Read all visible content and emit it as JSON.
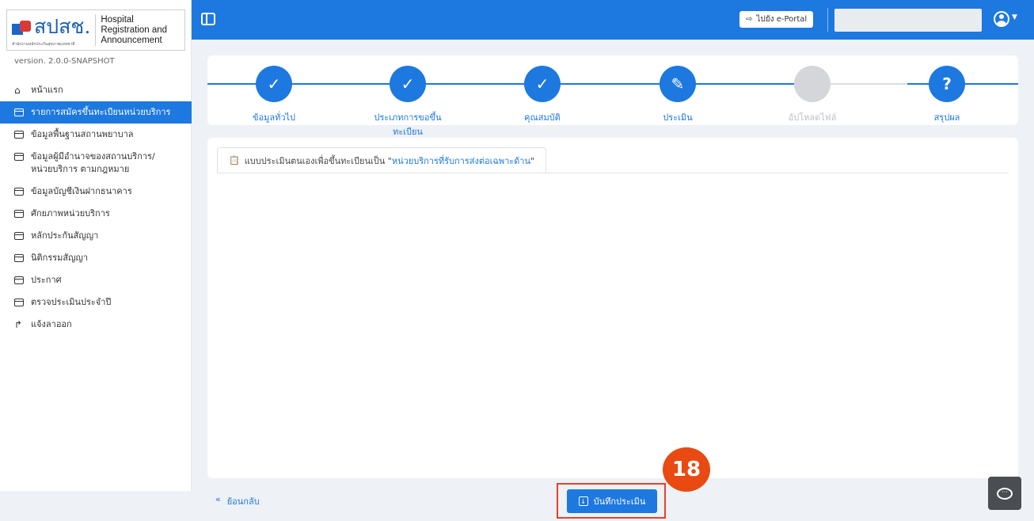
{
  "logo": {
    "thai": "สปสช.",
    "sub": "สำนักงานหลักประกันสุขภาพแห่งชาติ",
    "eng_lines": [
      "Hospital",
      "Registration and",
      "Announcement"
    ]
  },
  "version": "version. 2.0.0-SNAPSHOT",
  "sidebar": {
    "items": [
      {
        "label": "หน้าแรก",
        "icon": "home-icon"
      },
      {
        "label": "รายการสมัครขึ้นทะเบียนหน่วยบริการ",
        "icon": "form-icon",
        "active": true
      },
      {
        "label": "ข้อมูลพื้นฐานสถานพยาบาล",
        "icon": "form-icon"
      },
      {
        "label": "ข้อมูลผู้มีอำนาจของสถานบริการ/ หน่วยบริการ ตามกฎหมาย",
        "icon": "form-icon"
      },
      {
        "label": "ข้อมูลบัญชีเงินฝากธนาคาร",
        "icon": "form-icon"
      },
      {
        "label": "ศักยภาพหน่วยบริการ",
        "icon": "form-icon"
      },
      {
        "label": "หลักประกันสัญญา",
        "icon": "form-icon"
      },
      {
        "label": "นิติกรรมสัญญา",
        "icon": "form-icon"
      },
      {
        "label": "ประกาศ",
        "icon": "form-icon"
      },
      {
        "label": "ตรวจประเมินประจำปี",
        "icon": "form-icon"
      },
      {
        "label": "แจ้งลาออก",
        "icon": "exit-icon"
      }
    ]
  },
  "topbar": {
    "eportal_label": "ไปยัง e-Portal"
  },
  "stepper": {
    "steps": [
      {
        "label": "ข้อมูลทั่วไป",
        "icon": "check-icon",
        "state": "done"
      },
      {
        "label": "ประเภทการขอขึ้นทะเบียน",
        "icon": "check-icon",
        "state": "done"
      },
      {
        "label": "คุณสมบัติ",
        "icon": "check-icon",
        "state": "done"
      },
      {
        "label": "ประเมิน",
        "icon": "edit-icon",
        "state": "current"
      },
      {
        "label": "อัปโหลดไฟล์",
        "icon": "",
        "state": "pending"
      },
      {
        "label": "สรุปผล",
        "icon": "question-icon",
        "state": "summary"
      }
    ]
  },
  "tab": {
    "prefix": "แบบประเมินตนเองเพื่อขึ้นทะเบียนเป็น \"",
    "highlight": "หน่วยบริการที่รับการส่งต่อเฉพาะด้าน",
    "suffix": "\""
  },
  "footer": {
    "back_label": "ย้อนกลับ",
    "save_label": "บันทึกประเมิน",
    "badge": "18"
  },
  "colors": {
    "primary": "#1d78e0",
    "highlight_box": "#e8402a",
    "badge": "#e84a12"
  }
}
